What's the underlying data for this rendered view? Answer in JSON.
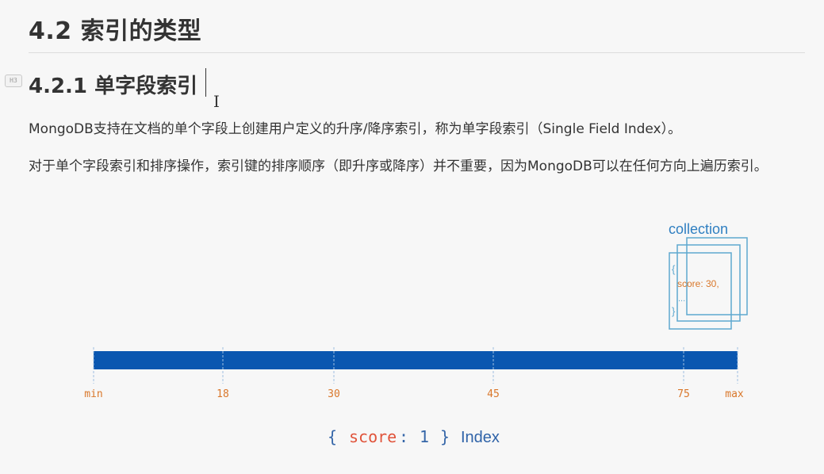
{
  "heading_h2": "4.2 索引的类型",
  "heading_marker": "H3",
  "heading_h3": "4.2.1 单字段索引",
  "cursor_glyph": "I",
  "paragraphs": [
    "MongoDB支持在文档的单个字段上创建用户定义的升序/降序索引，称为单字段索引（Single Field Index）。",
    "对于单个字段索引和排序操作，索引键的排序顺序（即升序或降序）并不重要，因为MongoDB可以在任何方向上遍历索引。"
  ],
  "diagram": {
    "collection_label": "collection",
    "doc_open": "{",
    "doc_field": "score: 30,",
    "doc_more": "...",
    "doc_close": "}",
    "ticks": [
      "min",
      "18",
      "30",
      "45",
      "75",
      "max"
    ],
    "caption": {
      "open": "{",
      "key": "score",
      "colon": ":",
      "value": "1",
      "close": "}",
      "word": "Index"
    },
    "colors": {
      "bar": "#0a57b0",
      "tick_label": "#d9772a",
      "doc_border": "#5ea8cf",
      "collection_text": "#2f7fc1",
      "caption_key": "#e0533a",
      "caption_brace": "#3566a8"
    }
  }
}
